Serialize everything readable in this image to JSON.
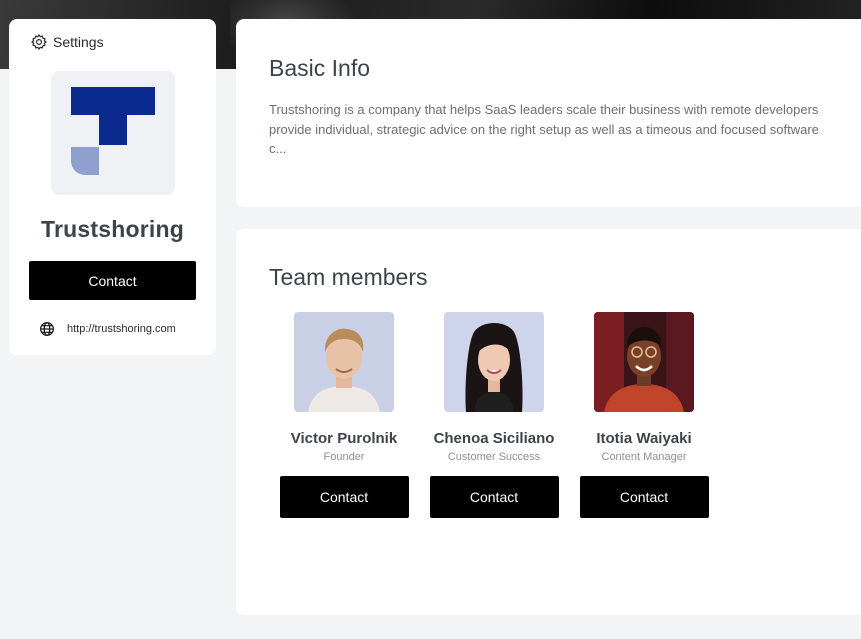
{
  "header": {
    "settings_label": "Settings"
  },
  "profile": {
    "company_name": "Trustshoring",
    "contact_label": "Contact",
    "website": "http://trustshoring.com",
    "brand_color": "#0a2a8f",
    "brand_light": "#8f9fce"
  },
  "basic_info": {
    "title": "Basic Info",
    "description_line1": "Trustshoring is a company that helps SaaS leaders scale their business with remote developers",
    "description_line2": "provide individual, strategic advice on the right setup as well as a timeous and focused software",
    "description_line3": "c..."
  },
  "team": {
    "title": "Team members",
    "members": [
      {
        "name": "Victor Purolnik",
        "role": "Founder",
        "contact_label": "Contact"
      },
      {
        "name": "Chenoa Siciliano",
        "role": "Customer Success",
        "contact_label": "Contact"
      },
      {
        "name": "Itotia Waiyaki",
        "role": "Content Manager",
        "contact_label": "Contact"
      }
    ]
  }
}
